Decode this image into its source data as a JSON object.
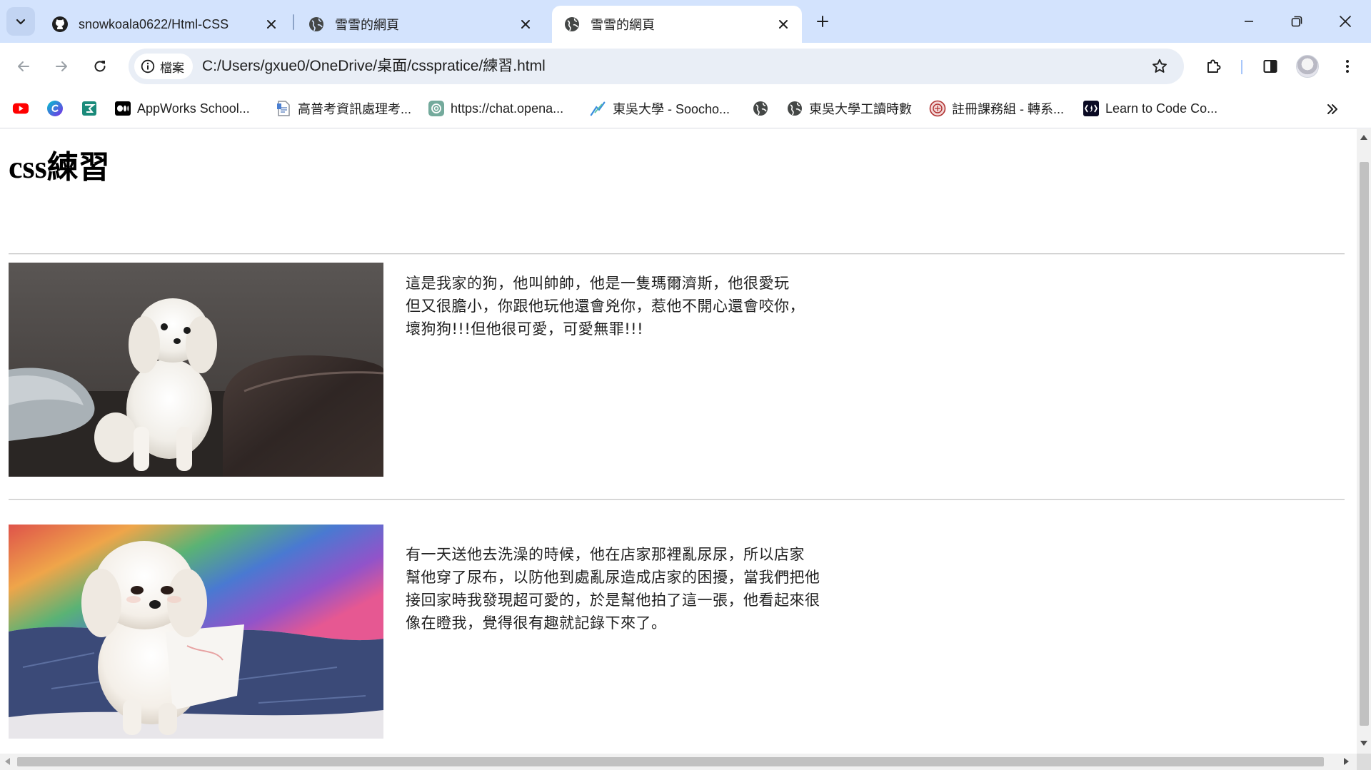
{
  "browser": {
    "tabs": [
      {
        "title": "snowkoala0622/Html-CSS",
        "favicon": "github-icon",
        "active": false
      },
      {
        "title": "雪雪的網頁",
        "favicon": "globe-icon",
        "active": false
      },
      {
        "title": "雪雪的網頁",
        "favicon": "globe-icon",
        "active": true
      }
    ],
    "address": {
      "chip_label": "檔案",
      "url": "C:/Users/gxue0/OneDrive/桌面/csspratice/練習.html"
    },
    "bookmarks": [
      {
        "label": "",
        "icon": "youtube-icon"
      },
      {
        "label": "",
        "icon": "canva-icon"
      },
      {
        "label": "",
        "icon": "bookmark-app-icon"
      },
      {
        "label": "AppWorks School...",
        "icon": "medium-icon"
      },
      {
        "label": "高普考資訊處理考...",
        "icon": "document-icon"
      },
      {
        "label": "https://chat.opena...",
        "icon": "openai-icon"
      },
      {
        "label": "東吳大學 - Soocho...",
        "icon": "soochow-icon"
      },
      {
        "label": "",
        "icon": "globe-icon"
      },
      {
        "label": "東吳大學工讀時數",
        "icon": "globe-icon"
      },
      {
        "label": "註冊課務組 - 轉系...",
        "icon": "seal-icon"
      },
      {
        "label": "Learn to Code  Co...",
        "icon": "freecodecamp-icon"
      }
    ],
    "colors": {
      "tabstrip": "#d3e3fd",
      "omnibox": "#e9eef6"
    }
  },
  "page": {
    "title": "css練習",
    "sections": [
      {
        "image_alt": "white maltese dog standing on a dark leather sofa",
        "lines": [
          "這是我家的狗，他叫帥帥，他是一隻瑪爾濟斯，他很愛玩",
          "但又很膽小，你跟他玩他還會兇你，惹他不開心還會咬你，",
          "壞狗狗!!!但他很可愛，可愛無罪!!!"
        ]
      },
      {
        "image_alt": "white maltese dog wearing a diaper sitting on a colorful blanket",
        "lines": [
          "有一天送他去洗澡的時候，他在店家那裡亂尿尿，所以店家",
          "幫他穿了尿布，以防他到處亂尿造成店家的困擾，當我們把他",
          "接回家時我發現超可愛的，於是幫他拍了這一張，他看起來很",
          "像在瞪我，覺得很有趣就記錄下來了。"
        ]
      }
    ]
  }
}
